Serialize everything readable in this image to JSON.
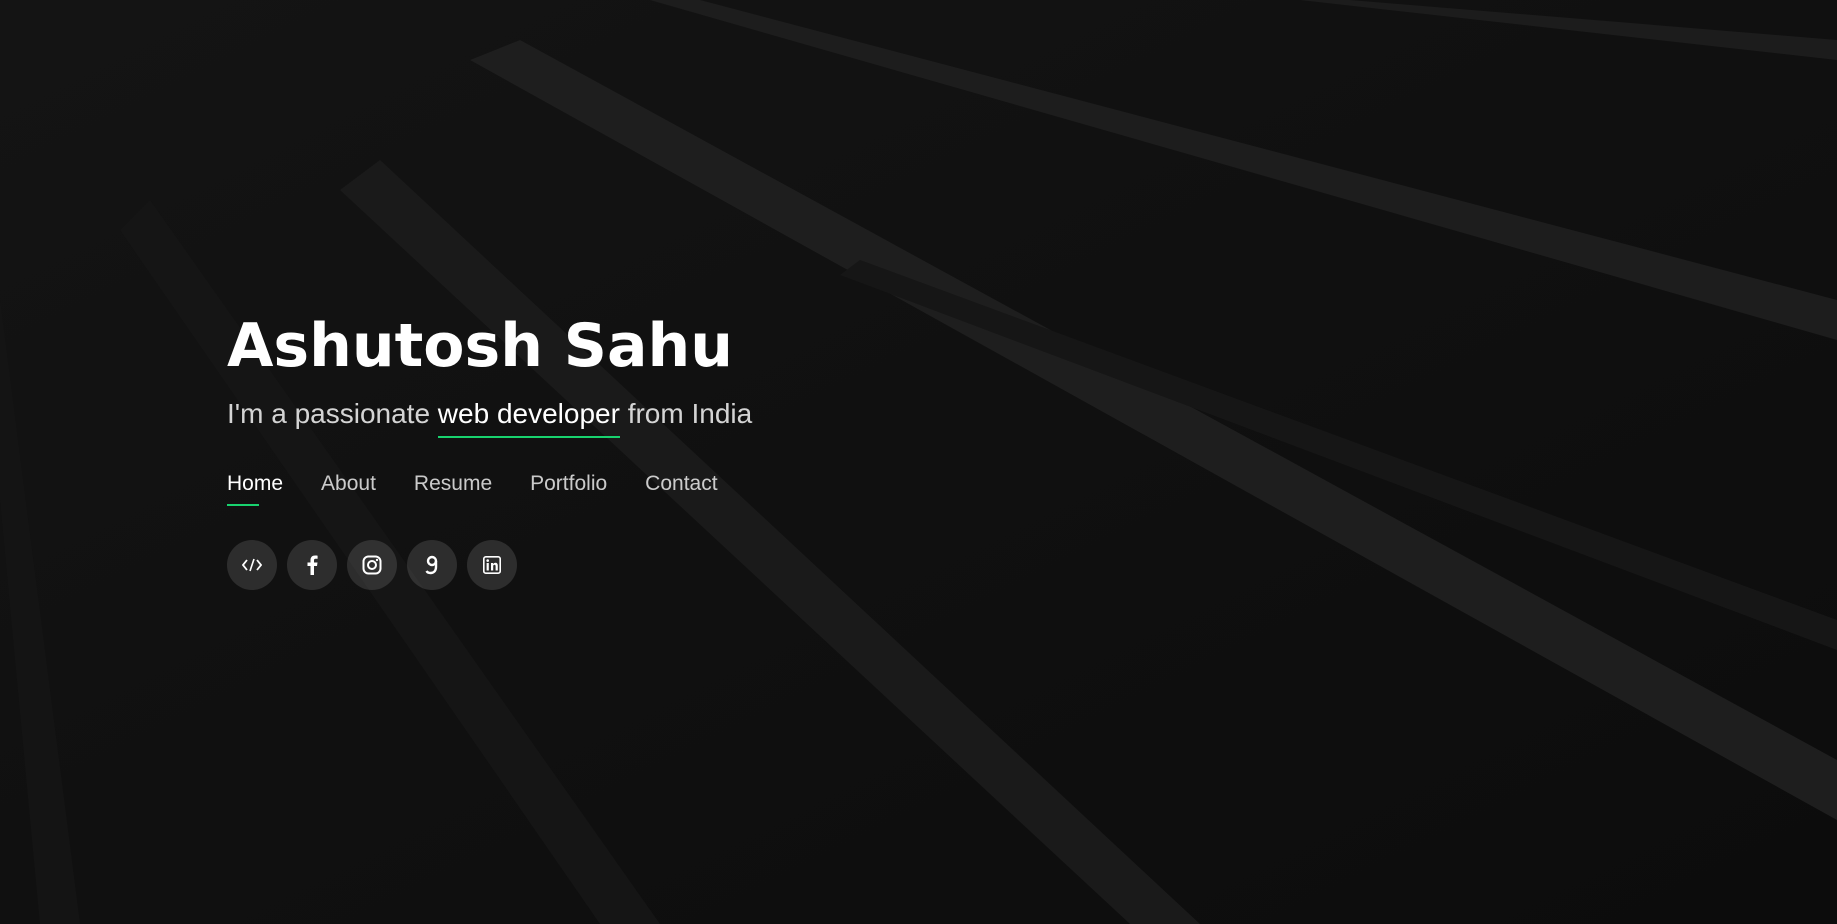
{
  "hero": {
    "name": "Ashutosh Sahu",
    "tagline_prefix": "I'm a passionate",
    "tagline_highlight": "web developer",
    "tagline_suffix": "from India"
  },
  "nav": {
    "items": [
      {
        "label": "Home",
        "active": true
      },
      {
        "label": "About",
        "active": false
      },
      {
        "label": "Resume",
        "active": false
      },
      {
        "label": "Portfolio",
        "active": false
      },
      {
        "label": "Contact",
        "active": false
      }
    ]
  },
  "social": {
    "icons": [
      "code-icon",
      "facebook-icon",
      "instagram-icon",
      "google-icon",
      "linkedin-icon"
    ]
  },
  "colors": {
    "accent": "#18d26e",
    "background": "#101010",
    "text": "#ffffff"
  }
}
